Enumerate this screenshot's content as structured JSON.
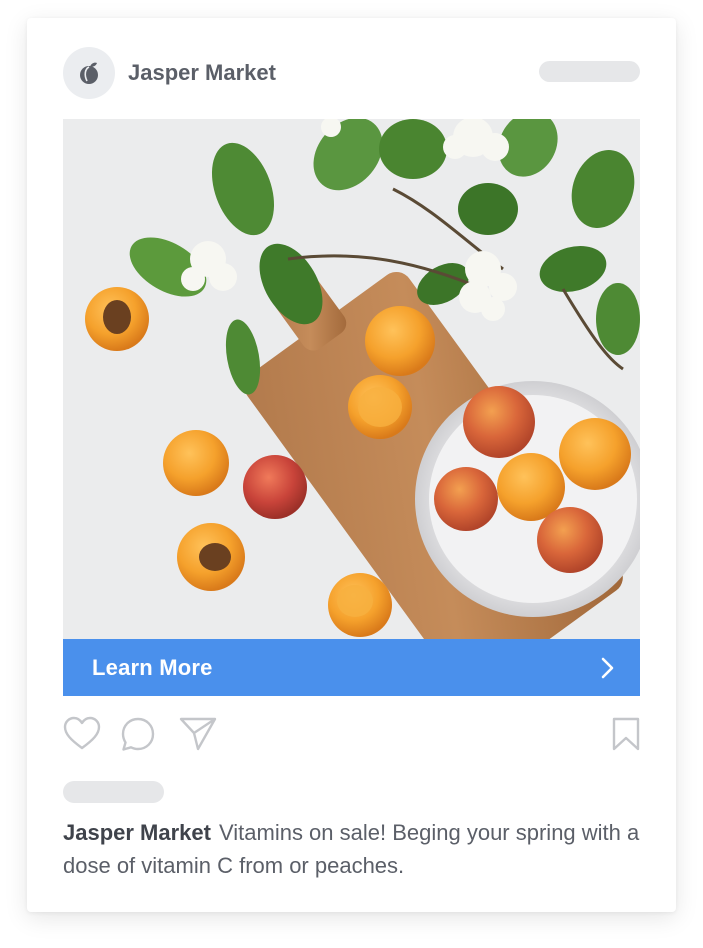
{
  "post": {
    "account_name": "Jasper Market",
    "avatar_icon": "peach-logo-icon",
    "cta_label": "Learn More",
    "cta_color": "#4a90ec",
    "caption_user": "Jasper Market",
    "caption_text": "Vitamins on sale! Beging your spring with a dose of vitamin C from or peaches."
  },
  "actions": {
    "like_icon": "heart-icon",
    "comment_icon": "comment-icon",
    "share_icon": "paper-plane-icon",
    "save_icon": "bookmark-icon"
  },
  "colors": {
    "text": "#5b5f68",
    "placeholder": "#e6e7e9",
    "icon": "#c4c6ca"
  }
}
